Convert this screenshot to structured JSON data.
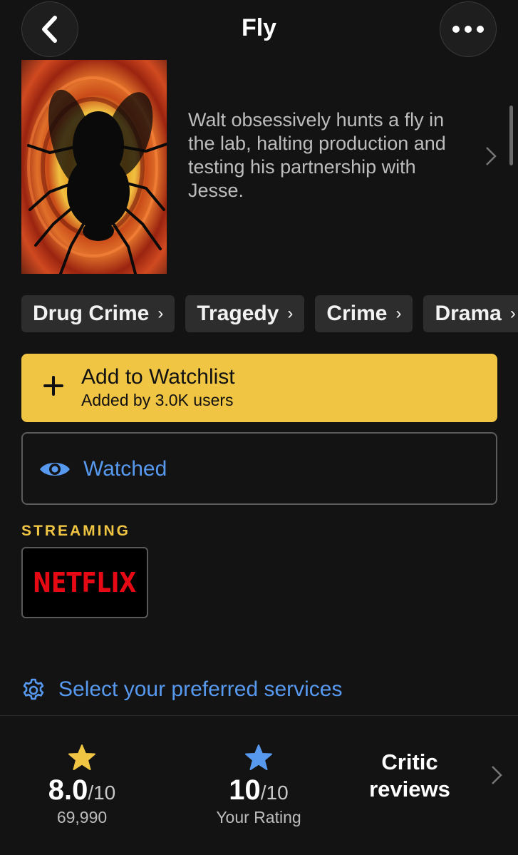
{
  "header": {
    "title": "Fly",
    "back_icon": "chevron-left-icon",
    "more_icon": "ellipsis-icon"
  },
  "episode": {
    "synopsis": "Walt obsessively hunts a fly in the lab, halting production and testing his partnership with Jesse."
  },
  "genres": [
    "Drug Crime",
    "Tragedy",
    "Crime",
    "Drama"
  ],
  "watchlist": {
    "label": "Add to Watchlist",
    "sublabel": "Added by 3.0K users"
  },
  "watched": {
    "label": "Watched"
  },
  "streaming": {
    "heading": "STREAMING",
    "provider": "NETFLIX"
  },
  "services": {
    "label": "Select your preferred services"
  },
  "ratings": {
    "imdb": {
      "value": "8.0",
      "out_of": "/10",
      "count": "69,990"
    },
    "user": {
      "value": "10",
      "out_of": "/10",
      "label": "Your Rating"
    },
    "critic": {
      "line1": "Critic",
      "line2": "reviews"
    }
  },
  "colors": {
    "accent_yellow": "#f0c544",
    "link_blue": "#5799ef",
    "netflix_red": "#e50914",
    "background": "#131313"
  }
}
